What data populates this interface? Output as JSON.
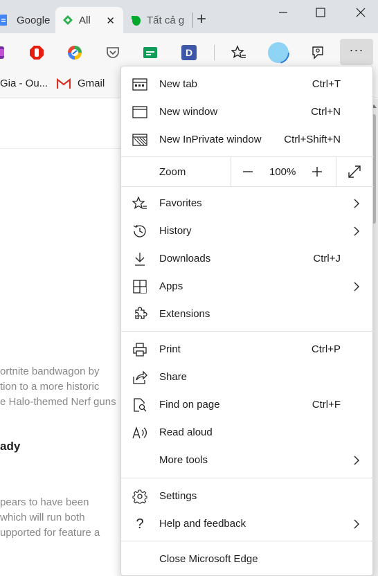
{
  "tabs": [
    {
      "title": "Google",
      "favicon": "google-docs-icon",
      "color": "#4285f4"
    },
    {
      "title": "All",
      "favicon": "feedly-icon",
      "color": "#2bb24c",
      "active": true
    },
    {
      "title": "Tất cả g",
      "favicon": "evernote-icon",
      "color": "#00a82d"
    }
  ],
  "window_controls": {
    "minimize": "—",
    "maximize": "☐",
    "close": "✕"
  },
  "toolbar_icons": [
    "extension-purple-icon",
    "adblock-icon",
    "chrome-color-icon",
    "pocket-icon",
    "sheets-icon",
    "d-extension-icon",
    "favorites-star-icon",
    "profile-avatar-icon",
    "feedback-icon"
  ],
  "toolbar": {
    "more_label": "···",
    "d_label": "D"
  },
  "favorites_bar": [
    {
      "label": "Gia - Ou...",
      "icon": "bookmark-icon"
    },
    {
      "label": "Gmail",
      "icon": "gmail-icon",
      "color": "#d93025"
    }
  ],
  "page": {
    "lines": [
      "ortnite bandwagon by",
      "tion to a more historic",
      "e Halo-themed Nerf guns",
      "pears to have been",
      " which will run both",
      "upported for feature a"
    ],
    "heading": "ady"
  },
  "menu": {
    "new_tab": {
      "label": "New tab",
      "shortcut": "Ctrl+T"
    },
    "new_window": {
      "label": "New window",
      "shortcut": "Ctrl+N"
    },
    "new_inprivate": {
      "label": "New InPrivate window",
      "shortcut": "Ctrl+Shift+N"
    },
    "zoom": {
      "label": "Zoom",
      "value": "100%"
    },
    "favorites": {
      "label": "Favorites"
    },
    "history": {
      "label": "History"
    },
    "downloads": {
      "label": "Downloads",
      "shortcut": "Ctrl+J"
    },
    "apps": {
      "label": "Apps"
    },
    "extensions": {
      "label": "Extensions"
    },
    "print": {
      "label": "Print",
      "shortcut": "Ctrl+P"
    },
    "share": {
      "label": "Share"
    },
    "find": {
      "label": "Find on page",
      "shortcut": "Ctrl+F"
    },
    "read_aloud": {
      "label": "Read aloud"
    },
    "more_tools": {
      "label": "More tools"
    },
    "settings": {
      "label": "Settings"
    },
    "help": {
      "label": "Help and feedback"
    },
    "close_edge": {
      "label": "Close Microsoft Edge"
    }
  }
}
